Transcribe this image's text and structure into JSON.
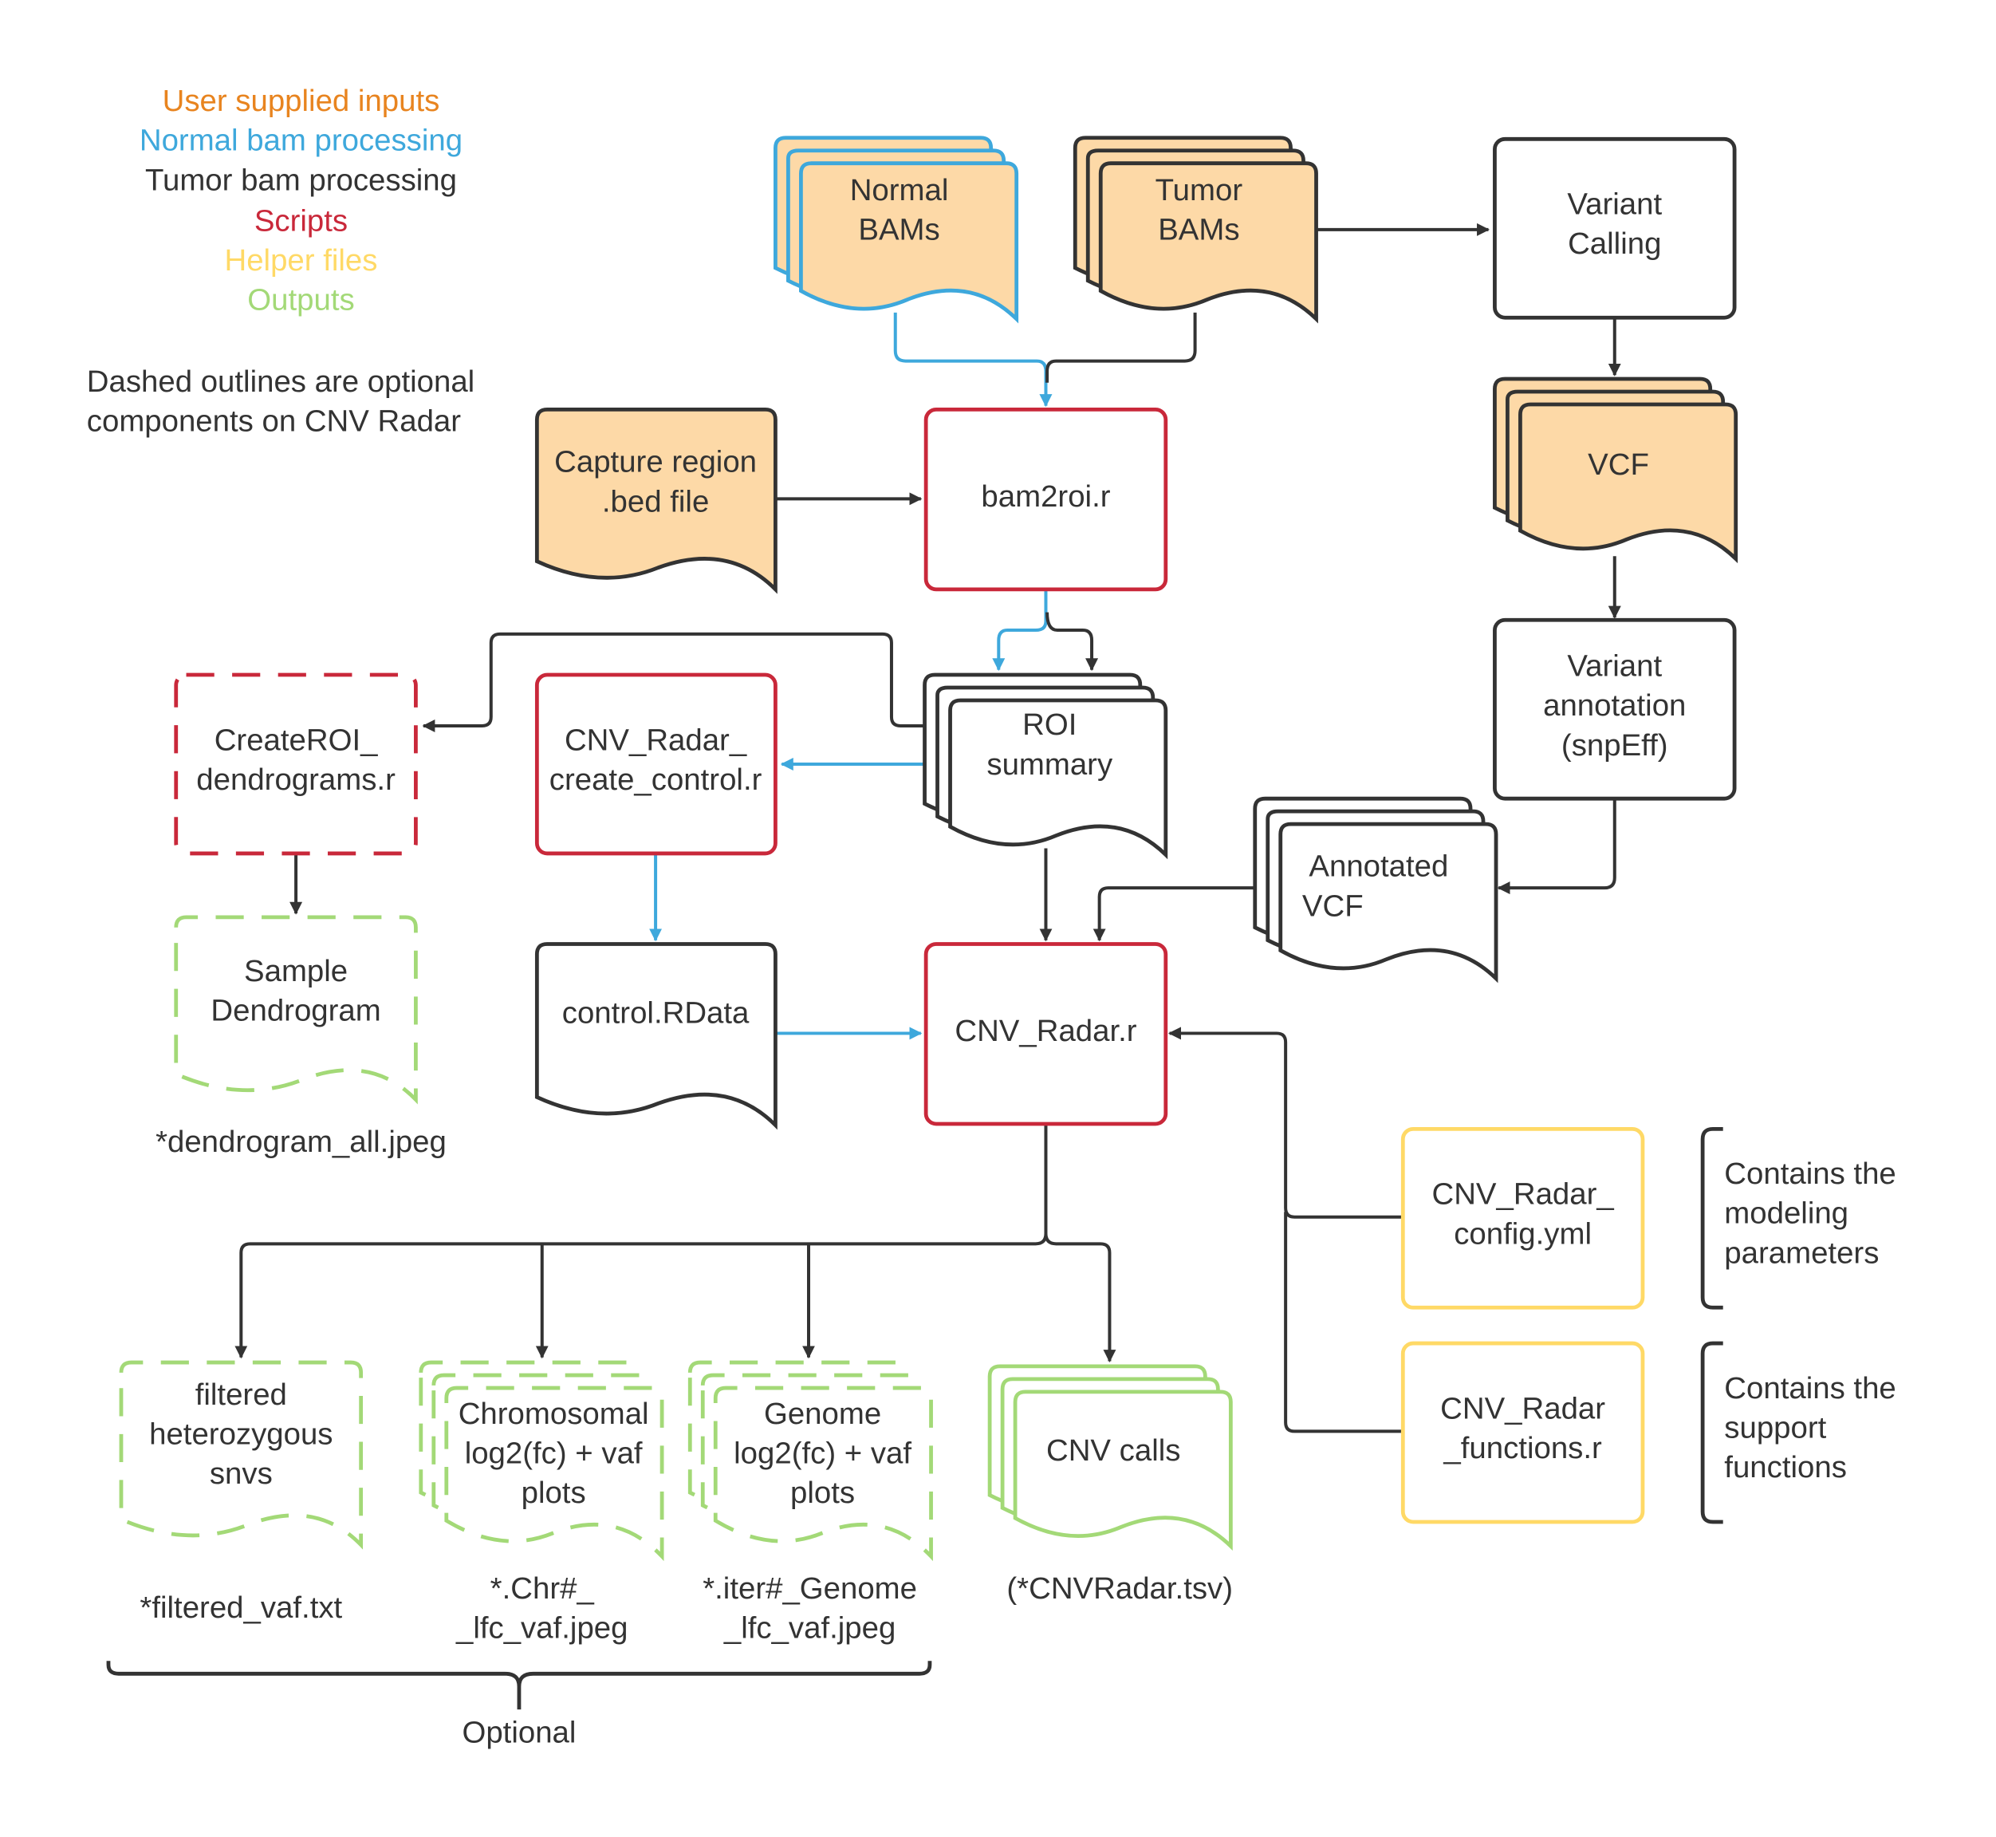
{
  "colors": {
    "user_inputs": "#e8841f",
    "normal": "#3ea8dc",
    "tumor": "#333333",
    "scripts": "#c9283a",
    "helper": "#ffd966",
    "outputs": "#a3d977",
    "input_fill": "#fdd9a7"
  },
  "legend": {
    "items": [
      {
        "label": "User supplied inputs",
        "color": "#e8841f"
      },
      {
        "label": "Normal bam processing",
        "color": "#3ea8dc"
      },
      {
        "label": "Tumor bam processing",
        "color": "#333333"
      },
      {
        "label": "Scripts",
        "color": "#c9283a"
      },
      {
        "label": "Helper files",
        "color": "#ffd966"
      },
      {
        "label": "Outputs",
        "color": "#a3d977"
      }
    ],
    "note": [
      "Dashed outlines are optional",
      "components on CNV Radar"
    ]
  },
  "nodes": {
    "normal_bams": [
      "Normal",
      "BAMs"
    ],
    "tumor_bams": [
      "Tumor",
      "BAMs"
    ],
    "variant_calling": [
      "Variant",
      "Calling"
    ],
    "vcf": [
      "VCF"
    ],
    "capture_bed": [
      "Capture region",
      ".bed file"
    ],
    "bam2roi": [
      "bam2roi.r"
    ],
    "variant_annotation": [
      "Variant",
      "annotation",
      "(snpEff)"
    ],
    "create_roi_dendrograms": [
      "CreateROI_",
      "dendrograms.r"
    ],
    "create_control": [
      "CNV_Radar_",
      "create_control.r"
    ],
    "roi_summary": [
      "ROI",
      "summary"
    ],
    "annotated_vcf": [
      "Annotated",
      "VCF"
    ],
    "sample_dendrogram": [
      "Sample",
      "Dendrogram"
    ],
    "control_rdata": [
      "control.RData"
    ],
    "cnv_radar": [
      "CNV_Radar.r"
    ],
    "config_yml": [
      "CNV_Radar_",
      "config.yml"
    ],
    "functions_r": [
      "CNV_Radar",
      "_functions.r"
    ],
    "filtered_snvs": [
      "filtered",
      "heterozygous",
      "snvs"
    ],
    "chrom_plots": [
      "Chromosomal",
      "log2(fc) + vaf",
      "plots"
    ],
    "genome_plots": [
      "Genome",
      "log2(fc) + vaf",
      "plots"
    ],
    "cnv_calls": [
      "CNV calls"
    ]
  },
  "captions": {
    "dendrogram_file": [
      "*dendrogram_all.jpeg"
    ],
    "filtered_file": [
      "*filtered_vaf.txt"
    ],
    "chrom_file": [
      "*.Chr#_",
      "_lfc_vaf.jpeg"
    ],
    "genome_file": [
      "*.iter#_Genome",
      "_lfc_vaf.jpeg"
    ],
    "cnv_file": [
      "(*CNVRadar.tsv)"
    ],
    "optional": [
      "Optional"
    ],
    "config_note": [
      "Contains the",
      "modeling",
      "parameters"
    ],
    "functions_note": [
      "Contains the",
      "support",
      "functions"
    ]
  }
}
